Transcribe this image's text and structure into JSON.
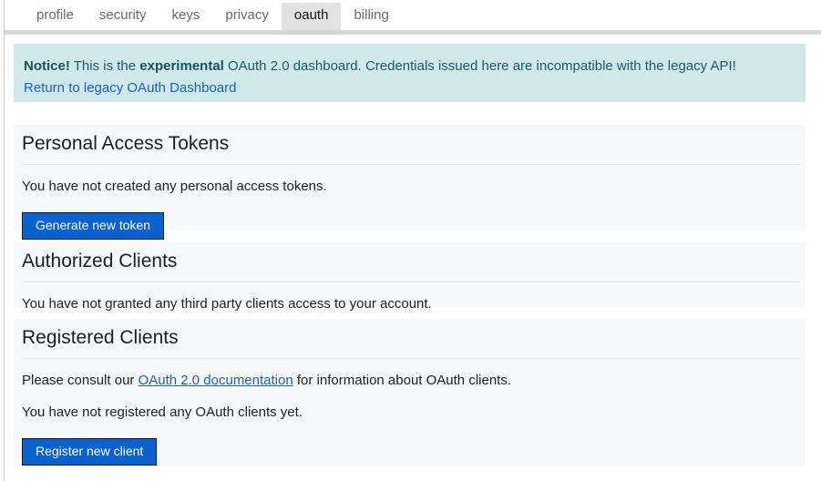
{
  "tabs": [
    {
      "label": "profile",
      "selected": false
    },
    {
      "label": "security",
      "selected": false
    },
    {
      "label": "keys",
      "selected": false
    },
    {
      "label": "privacy",
      "selected": false
    },
    {
      "label": "oauth",
      "selected": true
    },
    {
      "label": "billing",
      "selected": false
    }
  ],
  "notice": {
    "prefix": "Notice!",
    "text_before_emphasis": "This is the",
    "emphasis": "experimental",
    "text_after_emphasis": "OAuth 2.0 dashboard. Credentials issued here are incompatible with the legacy API!",
    "link_label": "Return to legacy OAuth Dashboard",
    "background_color": "#cfe8ea",
    "text_color": "#1b5a63",
    "link_color": "#1a5fd0"
  },
  "sections": {
    "personal_access_tokens": {
      "title": "Personal Access Tokens",
      "empty_text": "You have not created any personal access tokens.",
      "button_label": "Generate new token"
    },
    "authorized_clients": {
      "title": "Authorized Clients",
      "empty_text": "You have not granted any third party clients access to your account."
    },
    "registered_clients": {
      "title": "Registered Clients",
      "consult_prefix": "Please consult our",
      "doc_link_label": "OAuth 2.0 documentation",
      "consult_suffix": "for information about OAuth clients.",
      "empty_text": "You have not registered any OAuth clients yet.",
      "button_label": "Register new client"
    }
  },
  "colors": {
    "button_background": "#0a62d0",
    "button_border": "#0c1a33",
    "card_background": "#f6f8f9",
    "selected_tab_background": "#e2e2e2"
  }
}
